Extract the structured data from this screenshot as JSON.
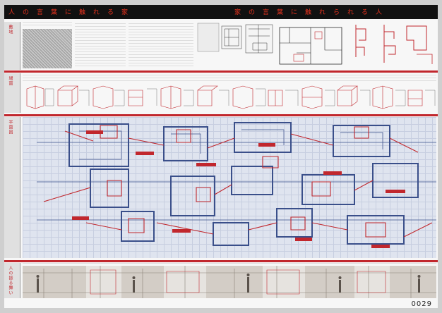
{
  "title": {
    "left": "人の言葉に触れる家",
    "right": "家の言葉に触れられる人"
  },
  "sections": [
    {
      "id": "site",
      "label": "敷地"
    },
    {
      "id": "scenes",
      "label": "場面"
    },
    {
      "id": "plan",
      "label": "平面図"
    },
    {
      "id": "photo",
      "label": "人の振る舞い"
    }
  ],
  "page_number": "0029",
  "colors": {
    "accent_red": "#c1272d",
    "title_red": "#e8321e",
    "ink_blue": "#3a4f8a",
    "plan_background": "#dfe4ef",
    "title_band": "#111111"
  }
}
